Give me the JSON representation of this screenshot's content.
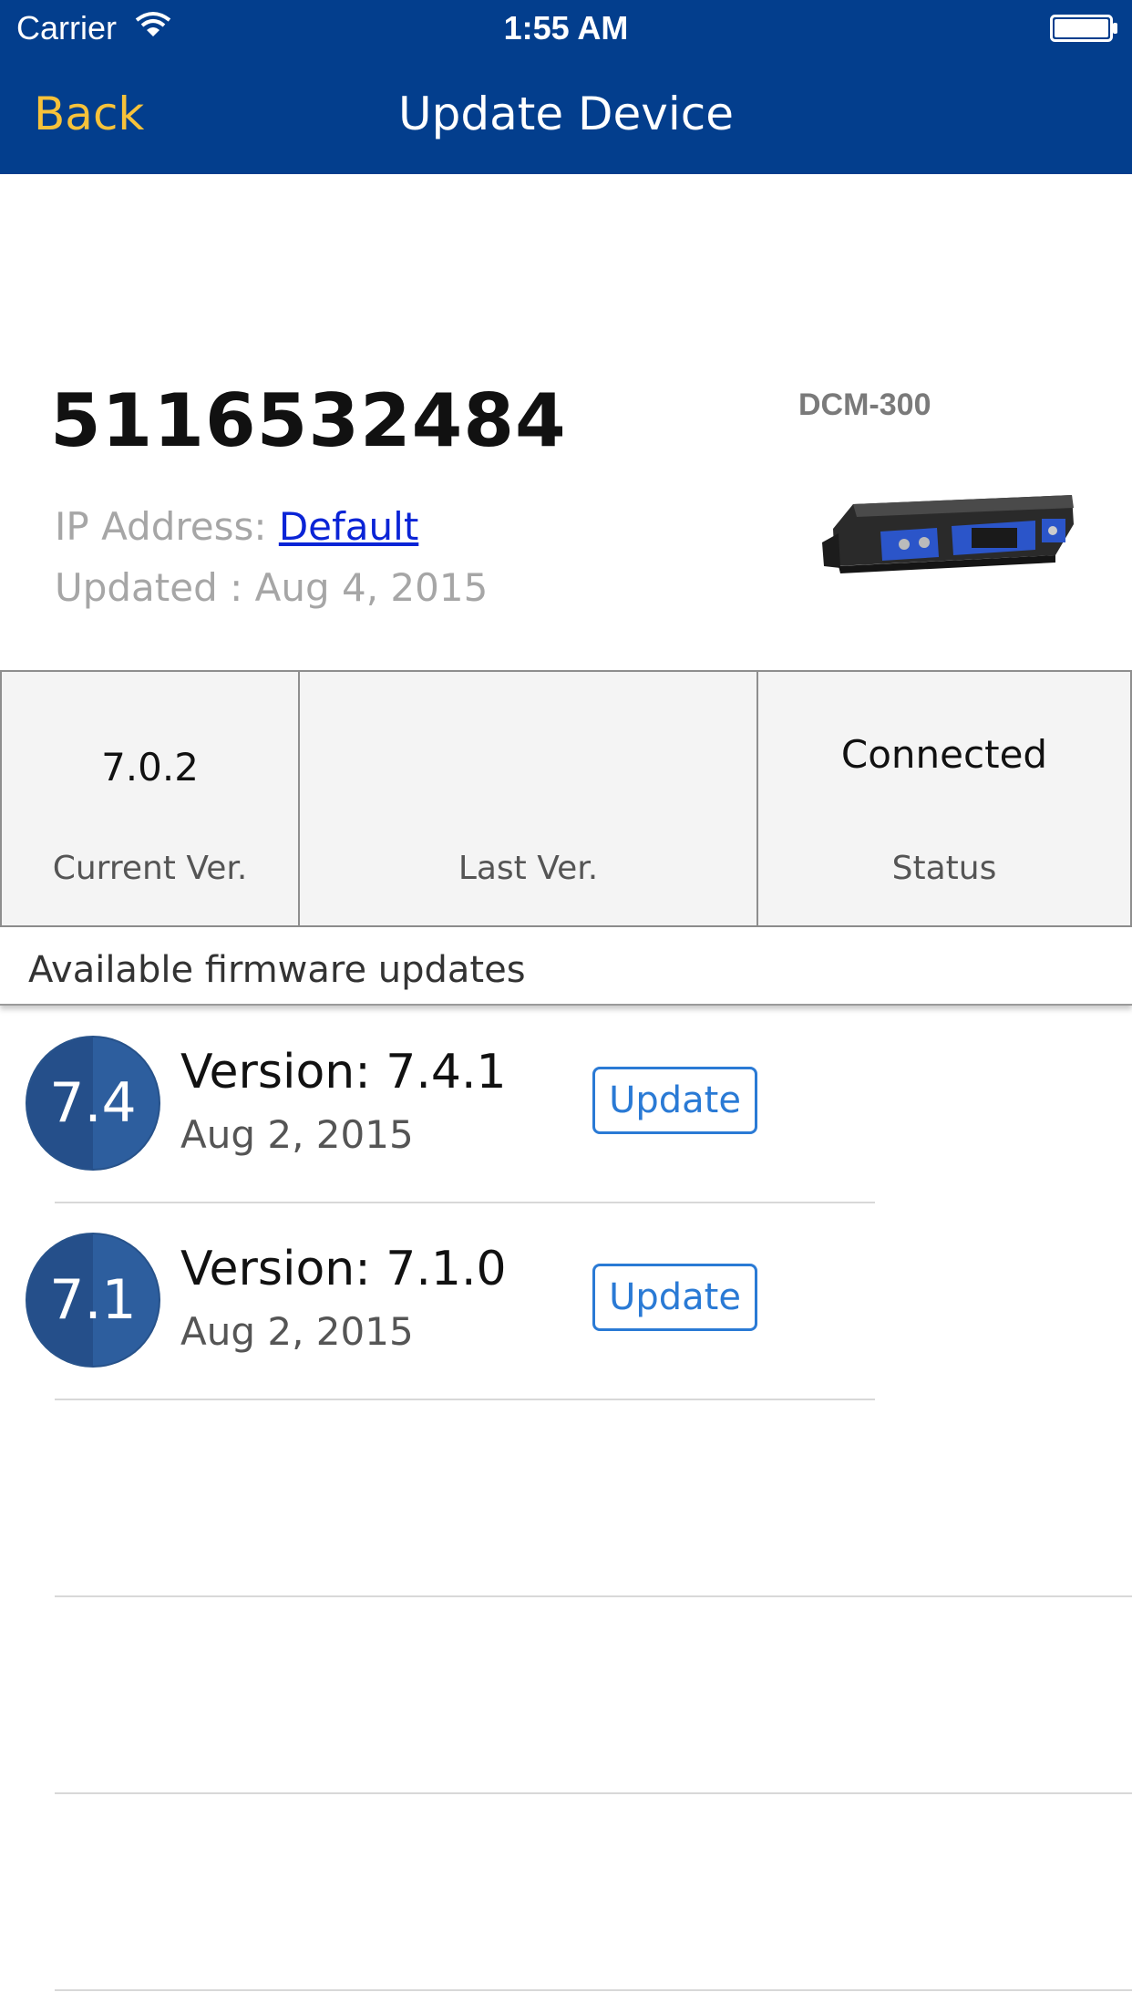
{
  "status_bar": {
    "carrier": "Carrier",
    "time": "1:55 AM"
  },
  "nav": {
    "back_label": "Back",
    "title": "Update Device"
  },
  "device": {
    "serial": "5116532484",
    "ip_label": "IP Address: ",
    "ip_value": "Default",
    "updated": "Updated : Aug 4, 2015",
    "model": "DCM-300"
  },
  "stats": {
    "current_version": {
      "value": "7.0.2",
      "label": "Current Ver."
    },
    "last_version": {
      "value": "",
      "label": "Last Ver."
    },
    "status": {
      "value": "Connected",
      "label": "Status"
    }
  },
  "section": {
    "title": "Available firmware updates"
  },
  "firmware_updates": [
    {
      "badge": "7.4",
      "version": "Version: 7.4.1",
      "date": "Aug 2, 2015",
      "action": "Update"
    },
    {
      "badge": "7.1",
      "version": "Version: 7.1.0",
      "date": "Aug 2, 2015",
      "action": "Update"
    }
  ],
  "colors": {
    "nav_background": "#033e8d",
    "back_accent": "#f7c23a",
    "link": "#0a24d6",
    "button_accent": "#2a7ad5",
    "badge": "#2d5e9e"
  }
}
